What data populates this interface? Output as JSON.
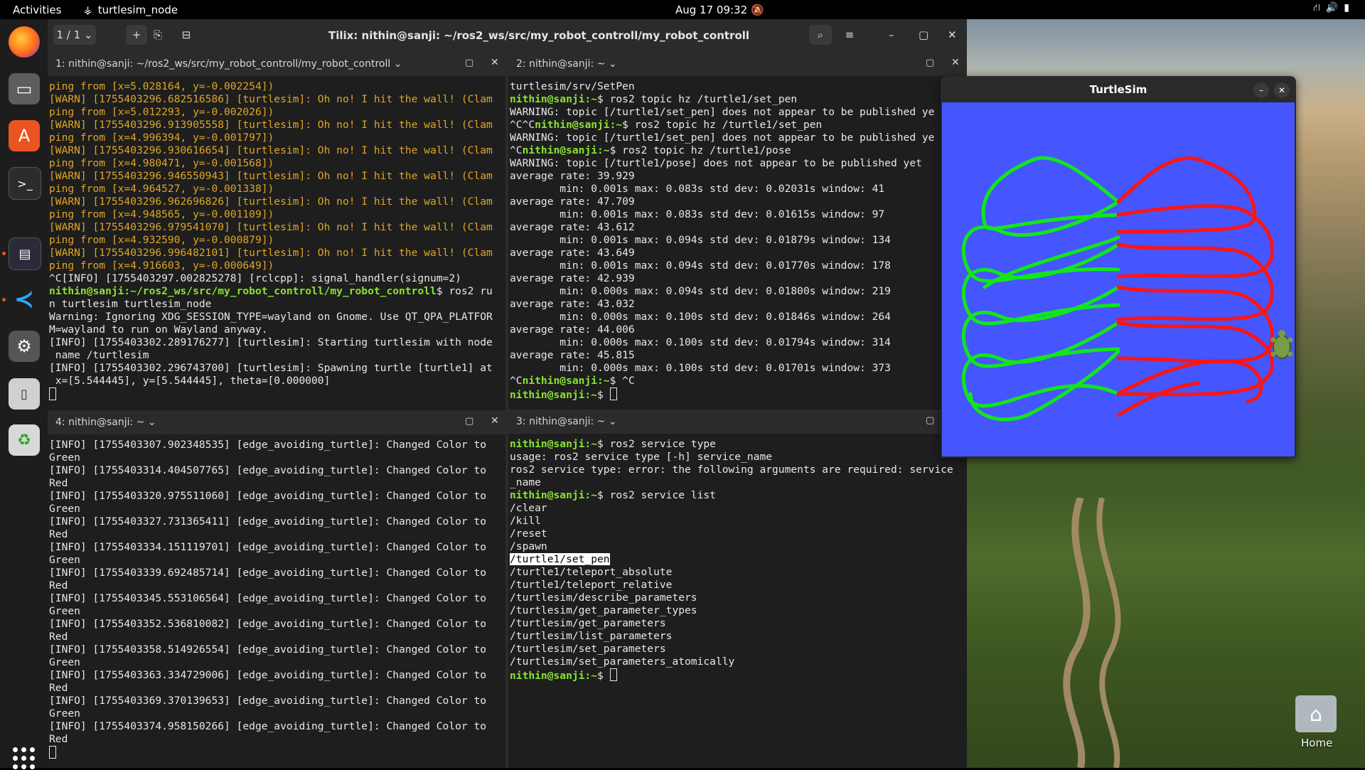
{
  "topbar": {
    "activities": "Activities",
    "app_name": "turtlesim_node",
    "clock": "Aug 17  09:32"
  },
  "tilix": {
    "session": "1 / 1",
    "title": "Tilix: nithin@sanji: ~/ros2_ws/src/my_robot_controll/my_robot_controll"
  },
  "panes": {
    "p1": {
      "title": "1: nithin@sanji: ~/ros2_ws/src/my_robot_controll/my_robot_controll",
      "lines": [
        {
          "t": "ping from [x=5.028164, y=-0.002254])",
          "c": "warn"
        },
        {
          "t": "[WARN] [1755403296.682516586] [turtlesim]: Oh no! I hit the wall! (Clam",
          "c": "warn"
        },
        {
          "t": "ping from [x=5.012293, y=-0.002026])",
          "c": "warn"
        },
        {
          "t": "[WARN] [1755403296.913905558] [turtlesim]: Oh no! I hit the wall! (Clam",
          "c": "warn"
        },
        {
          "t": "ping from [x=4.996394, y=-0.001797])",
          "c": "warn"
        },
        {
          "t": "[WARN] [1755403296.930616654] [turtlesim]: Oh no! I hit the wall! (Clam",
          "c": "warn"
        },
        {
          "t": "ping from [x=4.980471, y=-0.001568])",
          "c": "warn"
        },
        {
          "t": "[WARN] [1755403296.946550943] [turtlesim]: Oh no! I hit the wall! (Clam",
          "c": "warn"
        },
        {
          "t": "ping from [x=4.964527, y=-0.001338])",
          "c": "warn"
        },
        {
          "t": "[WARN] [1755403296.962696826] [turtlesim]: Oh no! I hit the wall! (Clam",
          "c": "warn"
        },
        {
          "t": "ping from [x=4.948565, y=-0.001109])",
          "c": "warn"
        },
        {
          "t": "[WARN] [1755403296.979541070] [turtlesim]: Oh no! I hit the wall! (Clam",
          "c": "warn"
        },
        {
          "t": "ping from [x=4.932590, y=-0.000879])",
          "c": "warn"
        },
        {
          "t": "[WARN] [1755403296.996482101] [turtlesim]: Oh no! I hit the wall! (Clam",
          "c": "warn"
        },
        {
          "t": "ping from [x=4.916603, y=-0.000649])",
          "c": "warn"
        },
        {
          "t": "^C[INFO] [1755403297.002825278] [rclcpp]: signal_handler(signum=2)",
          "c": ""
        },
        {
          "p": "nithin@sanji:~/ros2_ws/src/my_robot_controll/my_robot_controll",
          "t": "$ ros2 ru",
          "c": ""
        },
        {
          "t": "n turtlesim turtlesim_node",
          "c": ""
        },
        {
          "t": "Warning: Ignoring XDG_SESSION_TYPE=wayland on Gnome. Use QT_QPA_PLATFOR",
          "c": ""
        },
        {
          "t": "M=wayland to run on Wayland anyway.",
          "c": ""
        },
        {
          "t": "[INFO] [1755403302.289176277] [turtlesim]: Starting turtlesim with node",
          "c": ""
        },
        {
          "t": " name /turtlesim",
          "c": ""
        },
        {
          "t": "[INFO] [1755403302.296743700] [turtlesim]: Spawning turtle [turtle1] at",
          "c": ""
        },
        {
          "t": " x=[5.544445], y=[5.544445], theta=[0.000000]",
          "c": ""
        }
      ]
    },
    "p2": {
      "title": "2: nithin@sanji: ~",
      "lines": [
        {
          "t": "turtlesim/srv/SetPen",
          "c": ""
        },
        {
          "p": "nithin@sanji:~",
          "t": "$ ros2 topic hz /turtle1/set_pen",
          "c": ""
        },
        {
          "t": "WARNING: topic [/turtle1/set_pen] does not appear to be published ye",
          "c": ""
        },
        {
          "pre": "^C^C",
          "p": "nithin@sanji:~",
          "t": "$ ros2 topic hz /turtle1/set_pen",
          "c": ""
        },
        {
          "t": "WARNING: topic [/turtle1/set_pen] does not appear to be published ye",
          "c": ""
        },
        {
          "pre": "^C",
          "p": "nithin@sanji:~",
          "t": "$ ros2 topic hz /turtle1/pose",
          "c": ""
        },
        {
          "t": "WARNING: topic [/turtle1/pose] does not appear to be published yet",
          "c": ""
        },
        {
          "t": "average rate: 39.929",
          "c": ""
        },
        {
          "t": "        min: 0.001s max: 0.083s std dev: 0.02031s window: 41",
          "c": ""
        },
        {
          "t": "average rate: 47.709",
          "c": ""
        },
        {
          "t": "        min: 0.001s max: 0.083s std dev: 0.01615s window: 97",
          "c": ""
        },
        {
          "t": "average rate: 43.612",
          "c": ""
        },
        {
          "t": "        min: 0.001s max: 0.094s std dev: 0.01879s window: 134",
          "c": ""
        },
        {
          "t": "average rate: 43.649",
          "c": ""
        },
        {
          "t": "        min: 0.001s max: 0.094s std dev: 0.01770s window: 178",
          "c": ""
        },
        {
          "t": "average rate: 42.939",
          "c": ""
        },
        {
          "t": "        min: 0.000s max: 0.094s std dev: 0.01800s window: 219",
          "c": ""
        },
        {
          "t": "average rate: 43.032",
          "c": ""
        },
        {
          "t": "        min: 0.000s max: 0.100s std dev: 0.01846s window: 264",
          "c": ""
        },
        {
          "t": "average rate: 44.006",
          "c": ""
        },
        {
          "t": "        min: 0.000s max: 0.100s std dev: 0.01794s window: 314",
          "c": ""
        },
        {
          "t": "average rate: 45.815",
          "c": ""
        },
        {
          "t": "        min: 0.000s max: 0.100s std dev: 0.01701s window: 373",
          "c": ""
        },
        {
          "pre": "^C",
          "p": "nithin@sanji:~",
          "t": "$ ^C",
          "c": ""
        },
        {
          "p": "nithin@sanji:~",
          "t": "$ ",
          "c": "",
          "cursor": true
        }
      ]
    },
    "p3": {
      "title": "3: nithin@sanji: ~",
      "lines": [
        {
          "p": "nithin@sanji:~",
          "t": "$ ros2 service type",
          "c": ""
        },
        {
          "t": "usage: ros2 service type [-h] service_name",
          "c": ""
        },
        {
          "t": "ros2 service type: error: the following arguments are required: service",
          "c": ""
        },
        {
          "t": "_name",
          "c": ""
        },
        {
          "p": "nithin@sanji:~",
          "t": "$ ros2 service list",
          "c": ""
        },
        {
          "t": "/clear",
          "c": ""
        },
        {
          "t": "/kill",
          "c": ""
        },
        {
          "t": "/reset",
          "c": ""
        },
        {
          "t": "/spawn",
          "c": ""
        },
        {
          "t": "/turtle1/set_pen",
          "c": "hl"
        },
        {
          "t": "/turtle1/teleport_absolute",
          "c": ""
        },
        {
          "t": "/turtle1/teleport_relative",
          "c": ""
        },
        {
          "t": "/turtlesim/describe_parameters",
          "c": ""
        },
        {
          "t": "/turtlesim/get_parameter_types",
          "c": ""
        },
        {
          "t": "/turtlesim/get_parameters",
          "c": ""
        },
        {
          "t": "/turtlesim/list_parameters",
          "c": ""
        },
        {
          "t": "/turtlesim/set_parameters",
          "c": ""
        },
        {
          "t": "/turtlesim/set_parameters_atomically",
          "c": ""
        },
        {
          "p": "nithin@sanji:~",
          "t": "$ ",
          "c": "",
          "cursor": true
        }
      ]
    },
    "p4": {
      "title": "4: nithin@sanji: ~",
      "lines": [
        {
          "t": "[INFO] [1755403307.902348535] [edge_avoiding_turtle]: Changed Color to",
          "c": ""
        },
        {
          "t": "Green",
          "c": ""
        },
        {
          "t": "[INFO] [1755403314.404507765] [edge_avoiding_turtle]: Changed Color to",
          "c": ""
        },
        {
          "t": "Red",
          "c": ""
        },
        {
          "t": "[INFO] [1755403320.975511060] [edge_avoiding_turtle]: Changed Color to",
          "c": ""
        },
        {
          "t": "Green",
          "c": ""
        },
        {
          "t": "[INFO] [1755403327.731365411] [edge_avoiding_turtle]: Changed Color to",
          "c": ""
        },
        {
          "t": "Red",
          "c": ""
        },
        {
          "t": "[INFO] [1755403334.151119701] [edge_avoiding_turtle]: Changed Color to",
          "c": ""
        },
        {
          "t": "Green",
          "c": ""
        },
        {
          "t": "[INFO] [1755403339.692485714] [edge_avoiding_turtle]: Changed Color to",
          "c": ""
        },
        {
          "t": "Red",
          "c": ""
        },
        {
          "t": "[INFO] [1755403345.553106564] [edge_avoiding_turtle]: Changed Color to",
          "c": ""
        },
        {
          "t": "Green",
          "c": ""
        },
        {
          "t": "[INFO] [1755403352.536810082] [edge_avoiding_turtle]: Changed Color to",
          "c": ""
        },
        {
          "t": "Red",
          "c": ""
        },
        {
          "t": "[INFO] [1755403358.514926554] [edge_avoiding_turtle]: Changed Color to",
          "c": ""
        },
        {
          "t": "Green",
          "c": ""
        },
        {
          "t": "[INFO] [1755403363.334729006] [edge_avoiding_turtle]: Changed Color to",
          "c": ""
        },
        {
          "t": "Red",
          "c": ""
        },
        {
          "t": "[INFO] [1755403369.370139653] [edge_avoiding_turtle]: Changed Color to",
          "c": ""
        },
        {
          "t": "Green",
          "c": ""
        },
        {
          "t": "[INFO] [1755403374.958150266] [edge_avoiding_turtle]: Changed Color to",
          "c": ""
        },
        {
          "t": "Red",
          "c": ""
        }
      ]
    }
  },
  "turtlesim": {
    "title": "TurtleSim",
    "background": "#4556ff",
    "colors": {
      "green": "#12e61a",
      "red": "#ff1414"
    }
  },
  "desktop": {
    "home_label": "Home"
  },
  "colors": {
    "warn": "#e0a526",
    "prompt": "#8ae234",
    "accent": "#e95420"
  }
}
